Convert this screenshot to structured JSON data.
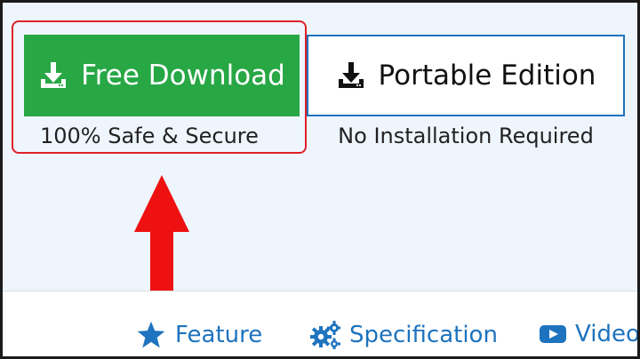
{
  "download": {
    "free_label": "Free Download",
    "free_caption": "100% Safe & Secure",
    "portable_label": "Portable Edition",
    "portable_caption": "No Installation Required"
  },
  "nav": {
    "feature": "Feature",
    "specification": "Specification",
    "video": "Video"
  },
  "colors": {
    "free_button": "#28a745",
    "portable_border": "#1e73be",
    "highlight": "#e0202a",
    "link": "#1e73be"
  },
  "icons": {
    "download": "download-icon",
    "feature": "star-icon",
    "specification": "gears-icon",
    "video": "video-play-icon",
    "annotation": "up-arrow"
  }
}
